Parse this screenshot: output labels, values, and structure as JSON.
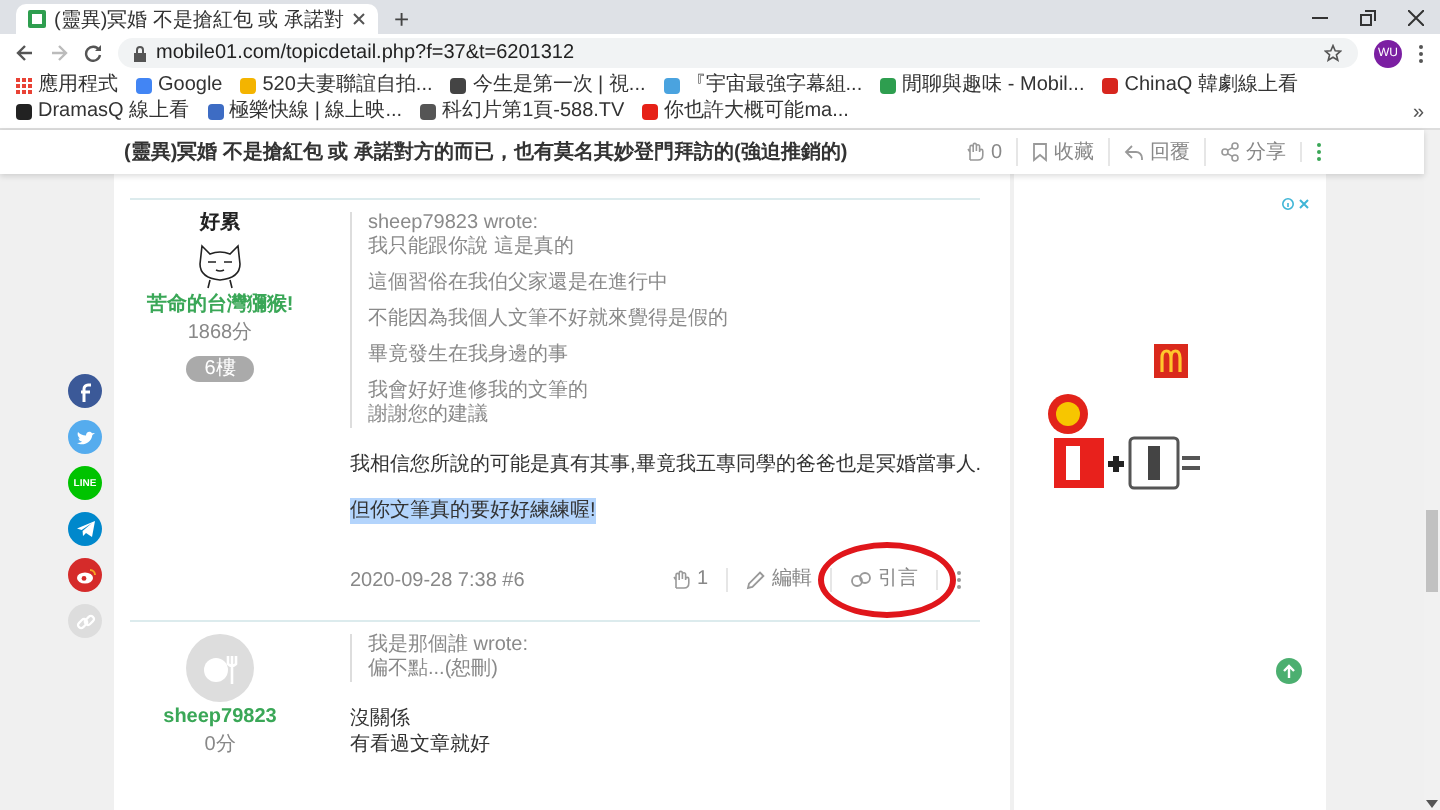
{
  "browser": {
    "tab_title": "(靈異)冥婚 不是搶紅包 或 承諾對",
    "new_tab": "+",
    "url": "mobile01.com/topicdetail.php?f=37&t=6201312",
    "profile": "WU",
    "more_bookmarks": "»",
    "bookmarks": [
      {
        "kind": "apps",
        "label": "應用程式",
        "color": "#e94235"
      },
      {
        "kind": "site",
        "label": "Google",
        "color": "#4285f4"
      },
      {
        "kind": "site",
        "label": "520夫妻聯誼自拍...",
        "color": "#f4b400"
      },
      {
        "kind": "site",
        "label": "今生是第一次 | 視...",
        "color": "#444444"
      },
      {
        "kind": "site",
        "label": "『宇宙最強字幕組...",
        "color": "#4aa3df"
      },
      {
        "kind": "site",
        "label": "閒聊與趣味 - Mobil...",
        "color": "#2e9e4f"
      },
      {
        "kind": "site",
        "label": "ChinaQ 韓劇線上看",
        "color": "#d7261e"
      },
      {
        "kind": "site",
        "label": "DramasQ 線上看",
        "color": "#222222"
      },
      {
        "kind": "site",
        "label": "極樂快線 | 線上映...",
        "color": "#3d6cc4"
      },
      {
        "kind": "site",
        "label": "科幻片第1頁-588.TV",
        "color": "#555555"
      },
      {
        "kind": "site",
        "label": "你也許大概可能ma...",
        "color": "#e62117"
      }
    ]
  },
  "topic_header": {
    "title": "(靈異)冥婚 不是搶紅包 或 承諾對方的而已，也有莫名其妙登門拜訪的(強迫推銷的)",
    "likes": "0",
    "actions": [
      {
        "kind": "bookmark",
        "label": "收藏"
      },
      {
        "kind": "reply",
        "label": "回覆"
      },
      {
        "kind": "share",
        "label": "分享"
      }
    ]
  },
  "share_bar": [
    {
      "kind": "facebook",
      "color": "#3b5998"
    },
    {
      "kind": "twitter",
      "color": "#55acee"
    },
    {
      "kind": "line",
      "color": "#00c300",
      "label": "LINE"
    },
    {
      "kind": "telegram",
      "color": "#0088cc"
    },
    {
      "kind": "weibo",
      "color": "#d52b2a"
    },
    {
      "kind": "link",
      "color": "#dddddd"
    }
  ],
  "posts": [
    {
      "author": {
        "kind": "cartoon",
        "avatar_caption": "好累",
        "name": "苦命的台灣獼猴!",
        "score": "1868分",
        "floor": "6樓"
      },
      "quote": {
        "author_line": "sheep79823 wrote:",
        "paragraphs": [
          [
            "我只能跟你說 這是真的"
          ],
          [
            "這個習俗在我伯父家還是在進行中"
          ],
          [
            "不能因為我個人文筆不好就來覺得是假的"
          ],
          [
            "畢竟發生在我身邊的事"
          ],
          [
            "我會好好進修我的文筆的",
            "謝謝您的建議"
          ]
        ]
      },
      "body": [
        {
          "lines": [
            "我相信您所說的可能是真有其事,畢竟我五專同學的爸爸也是冥婚當事人."
          ],
          "selected": false
        },
        {
          "lines": [
            "但你文筆真的要好好練練喔!"
          ],
          "selected": true
        }
      ],
      "footer": {
        "timestamp": "2020-09-28 7:38 #6",
        "likes": "1",
        "actions": [
          {
            "kind": "edit",
            "label": "編輯",
            "circled": false
          },
          {
            "kind": "quote",
            "label": "引言",
            "circled": true
          }
        ]
      }
    },
    {
      "author": {
        "kind": "default",
        "name": "sheep79823",
        "score": "0分"
      },
      "quote": {
        "author_line": "我是那個誰 wrote:",
        "paragraphs": [
          [
            "偏不點...(恕刪)"
          ]
        ]
      },
      "body": [
        {
          "lines": [
            "沒關係",
            "有看過文章就好"
          ],
          "selected": false
        }
      ]
    }
  ]
}
